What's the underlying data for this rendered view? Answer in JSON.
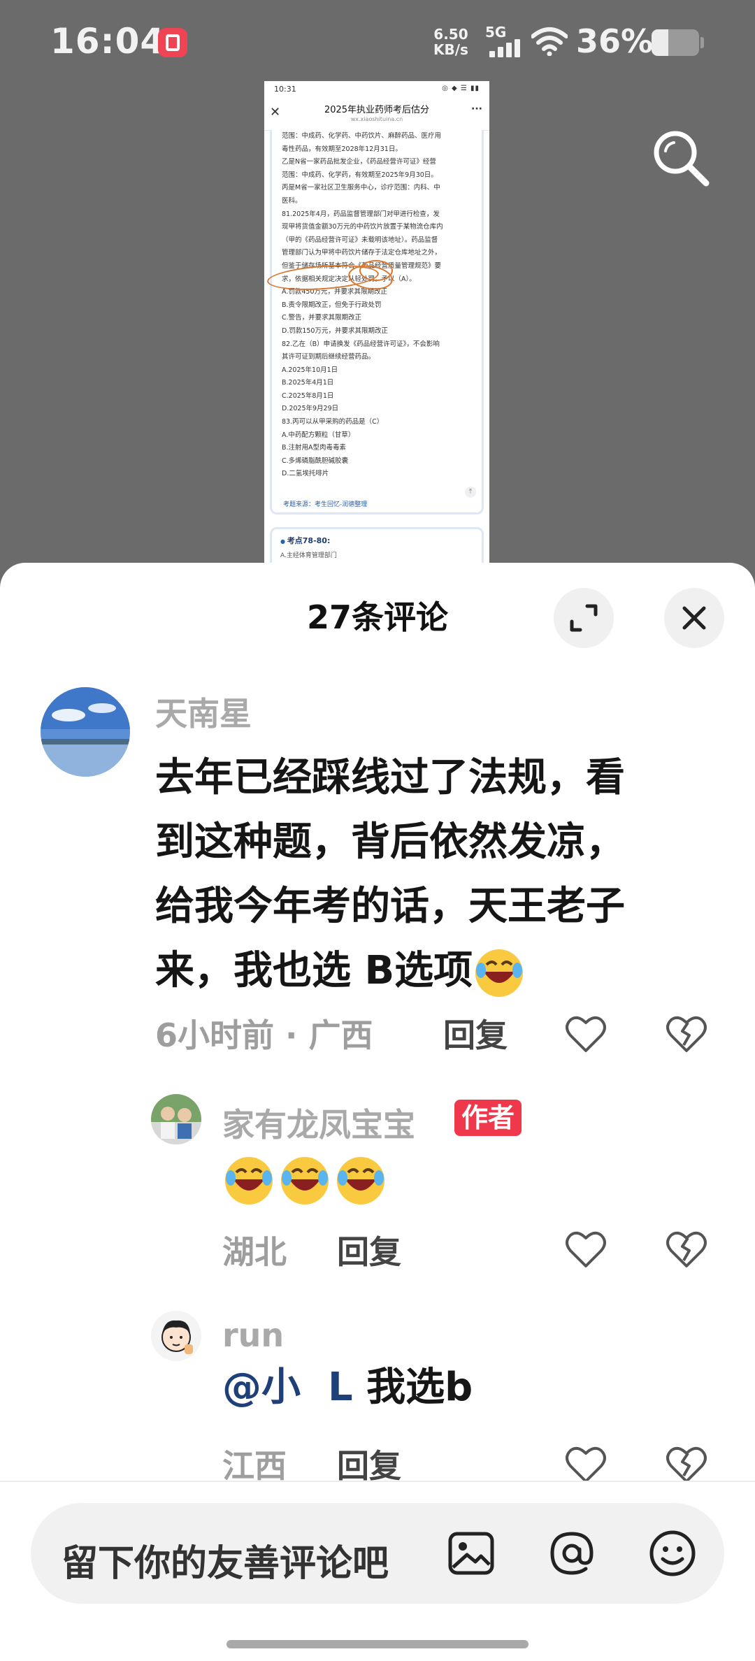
{
  "status_bar": {
    "time": "16:04",
    "net_speed_value": "6.50",
    "net_speed_unit": "KB/s",
    "network_type": "5G",
    "battery_percent": "36%",
    "battery_level": 0.36,
    "app_icon": "red-app-notification-icon"
  },
  "preview": {
    "status_time": "10:31",
    "status_icons": "◎ ◆ ☰ ▮▮",
    "title": "2025年执业药师考后估分",
    "url": "wx.xiaoshituina.cn",
    "lines": [
      "范围：中成药、化学药、中药饮片、麻醉药品、医疗用",
      "毒性药品，有效期至2028年12月31日。",
      "乙是N省一家药品批发企业，《药品经营许可证》经营",
      "范围：中成药、化学药，有效期至2025年9月30日。",
      "丙是M省一家社区卫生服务中心，诊疗范围：内科、中",
      "医科。",
      "81.2025年4月，药品监督管理部门对甲进行检查，发",
      "现甲将货值金额30万元的中药饮片放置于某物流仓库内",
      "（甲的《药品经营许可证》未载明该地址）。药品监督",
      "管理部门认为甲将中药饮片储存于法定仓库地址之外，",
      "但鉴于储存场所基本符合《药品经营质量管理规范》要",
      "求，依据相关规定决定从轻处罚，予以（A）。",
      "A.罚款450万元，并要求其限期改正",
      "B.责令限期改正，但免于行政处罚",
      "C.警告，并要求其限期改正",
      "D.罚款150万元，并要求其限期改正",
      "82.乙在（B）申请换发《药品经营许可证》，不会影响",
      "其许可证到期后继续经营药品。",
      "A.2025年10月1日",
      "B.2025年4月1日",
      "C.2025年8月1日",
      "D.2025年9月29日",
      "83.丙可以从甲采购的药品是（C）",
      "A.中药配方颗粒（甘草）",
      "B.注射用A型肉毒毒素",
      "C.多烯磷脂酰胆碱胶囊",
      "D.二氢埃托啡片"
    ],
    "source": "考题来源：考生回忆-润德整理",
    "next_section": "考点78-80:",
    "next_line": "A.主经体育管理部门"
  },
  "sheet": {
    "title": "27条评论"
  },
  "comments": [
    {
      "name": "天南星",
      "text_lines": [
        "去年已经踩线过了法规，看",
        "到这种题，背后依然发凉，",
        "给我今年考的话，天王老子",
        "来，我也选 B选项"
      ],
      "emoji": "face-with-tears-of-joy-emoji",
      "meta": "6小时前 · 广西",
      "reply": "回复"
    },
    {
      "name": "家有龙凤宝宝",
      "badge": "作者",
      "emoji_count": 3,
      "meta": "湖北",
      "reply": "回复"
    },
    {
      "name": "run",
      "mention": "@小  L",
      "text": " 我选b",
      "meta": "江西",
      "reply": "回复"
    }
  ],
  "input": {
    "placeholder": "留下你的友善评论吧"
  },
  "colors": {
    "author_badge": "#f0384d",
    "mention": "#1f3f78",
    "annotation_circle": "#d9772e"
  }
}
